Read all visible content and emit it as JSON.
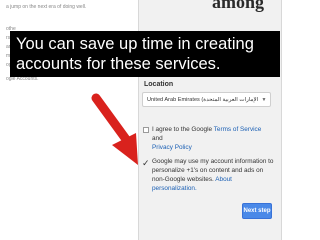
{
  "background_text": {
    "lines": [
      "a jump on the next era of doing  well.",
      "othe",
      "rs",
      "an",
      "m",
      "ogle",
      "ogle Accounts."
    ],
    "top_fragment": "among"
  },
  "caption": {
    "line1": "You can save up time in creating",
    "line2": "accounts for these services."
  },
  "form": {
    "location_label": "Location",
    "location_value": "United Arab Emirates (الإمارات العربية المتحدة)",
    "tos_text": "I agree to the Google ",
    "tos_link": "Terms of Service",
    "tos_and": " and",
    "privacy_link": "Privacy Policy",
    "personalize_text": "Google may use my account information to personalize +1's on content and ads on non-Google websites. ",
    "personalize_link": "About personalization.",
    "next_button": "Next step",
    "personalize_checked": true
  },
  "colors": {
    "caption_bg": "#000000",
    "arrow": "#d9221d",
    "link": "#1a5fb4",
    "button": "#4a89e8"
  },
  "icons": [
    "chevron-down-icon",
    "checkmark-icon",
    "red-arrow-icon"
  ]
}
